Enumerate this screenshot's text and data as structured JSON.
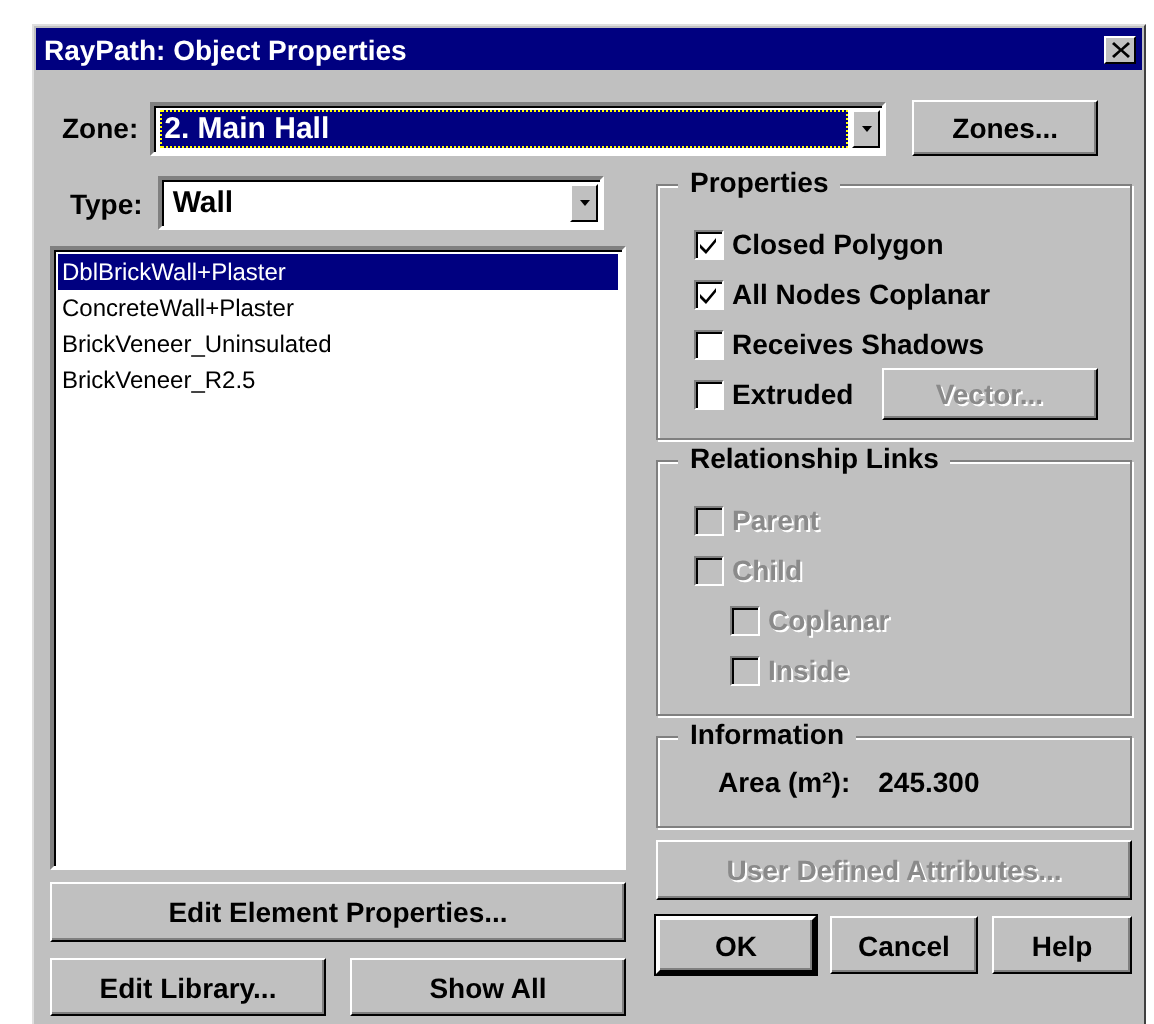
{
  "window": {
    "title": "RayPath: Object Properties"
  },
  "zone": {
    "label": "Zone:",
    "value": "2. Main Hall",
    "focused": true
  },
  "zones_button": {
    "label": "Zones...",
    "disabled": false
  },
  "type": {
    "label": "Type:",
    "value": "Wall"
  },
  "materials": [
    {
      "label": "DblBrickWall+Plaster",
      "selected": true
    },
    {
      "label": "ConcreteWall+Plaster",
      "selected": false
    },
    {
      "label": "BrickVeneer_Uninsulated",
      "selected": false
    },
    {
      "label": "BrickVeneer_R2.5",
      "selected": false
    }
  ],
  "properties": {
    "title": "Properties",
    "options": [
      {
        "label": "Closed Polygon",
        "checked": true,
        "disabled": false
      },
      {
        "label": "All Nodes Coplanar",
        "checked": true,
        "disabled": false
      },
      {
        "label": "Receives Shadows",
        "checked": false,
        "disabled": false
      },
      {
        "label": "Extruded",
        "checked": false,
        "disabled": false
      }
    ],
    "vector_button": {
      "label": "Vector...",
      "disabled": true
    }
  },
  "relationship_links": {
    "title": "Relationship Links",
    "options": [
      {
        "label": "Parent",
        "checked": false,
        "disabled": true
      },
      {
        "label": "Child",
        "checked": false,
        "disabled": true,
        "children": [
          {
            "label": "Coplanar",
            "checked": false,
            "disabled": true
          },
          {
            "label": "Inside",
            "checked": false,
            "disabled": true
          }
        ]
      }
    ]
  },
  "information": {
    "title": "Information",
    "area_label": "Area (m²):",
    "area_value": "245.300"
  },
  "edit_element_button": {
    "label": "Edit Element Properties...",
    "disabled": false
  },
  "user_attributes_button": {
    "label": "User Defined Attributes...",
    "disabled": true
  },
  "bottom_buttons": [
    {
      "label": "Edit Library...",
      "disabled": false,
      "default": false
    },
    {
      "label": "Show All",
      "disabled": false,
      "default": false
    },
    {
      "label": "OK",
      "disabled": false,
      "default": true
    },
    {
      "label": "Cancel",
      "disabled": false,
      "default": false
    },
    {
      "label": "Help",
      "disabled": false,
      "default": false
    }
  ]
}
